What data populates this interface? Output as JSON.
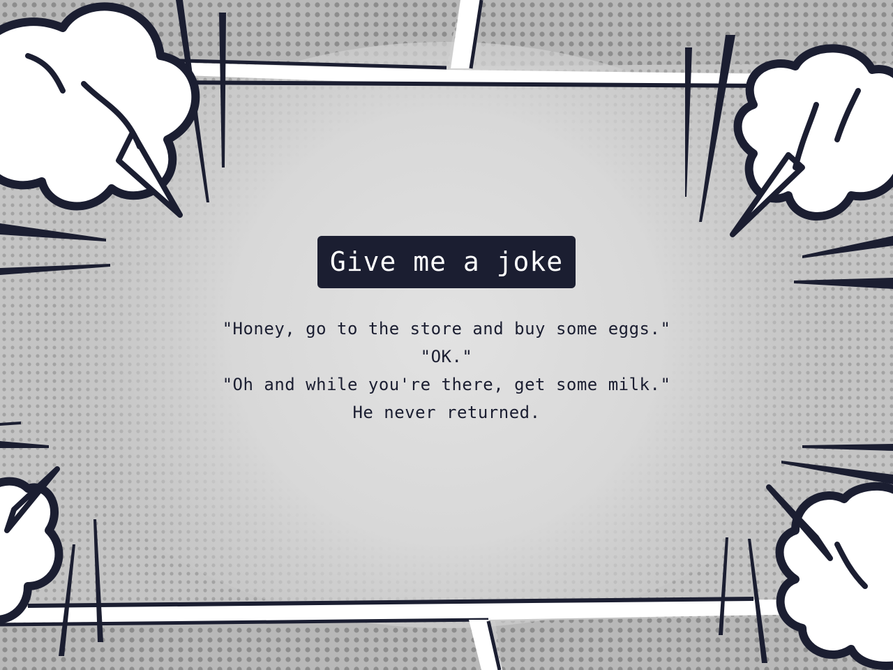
{
  "button": {
    "label": "Give me a joke"
  },
  "joke": {
    "lines": [
      "\"Honey, go to the store and buy some eggs.\"",
      "\"OK.\"",
      "\"Oh and while you're there, get some milk.\"",
      "He never returned."
    ]
  },
  "colors": {
    "ink": "#1b1e31",
    "cloud": "#ffffff",
    "halftone_bg": "#b9b9b9",
    "center": "#dcdcdc"
  },
  "decor": {
    "style": "comic-book halftone panel frame with speed lines and smoke puffs in each corner",
    "icons": [
      "smoke-puff-icon",
      "speed-lines"
    ]
  }
}
